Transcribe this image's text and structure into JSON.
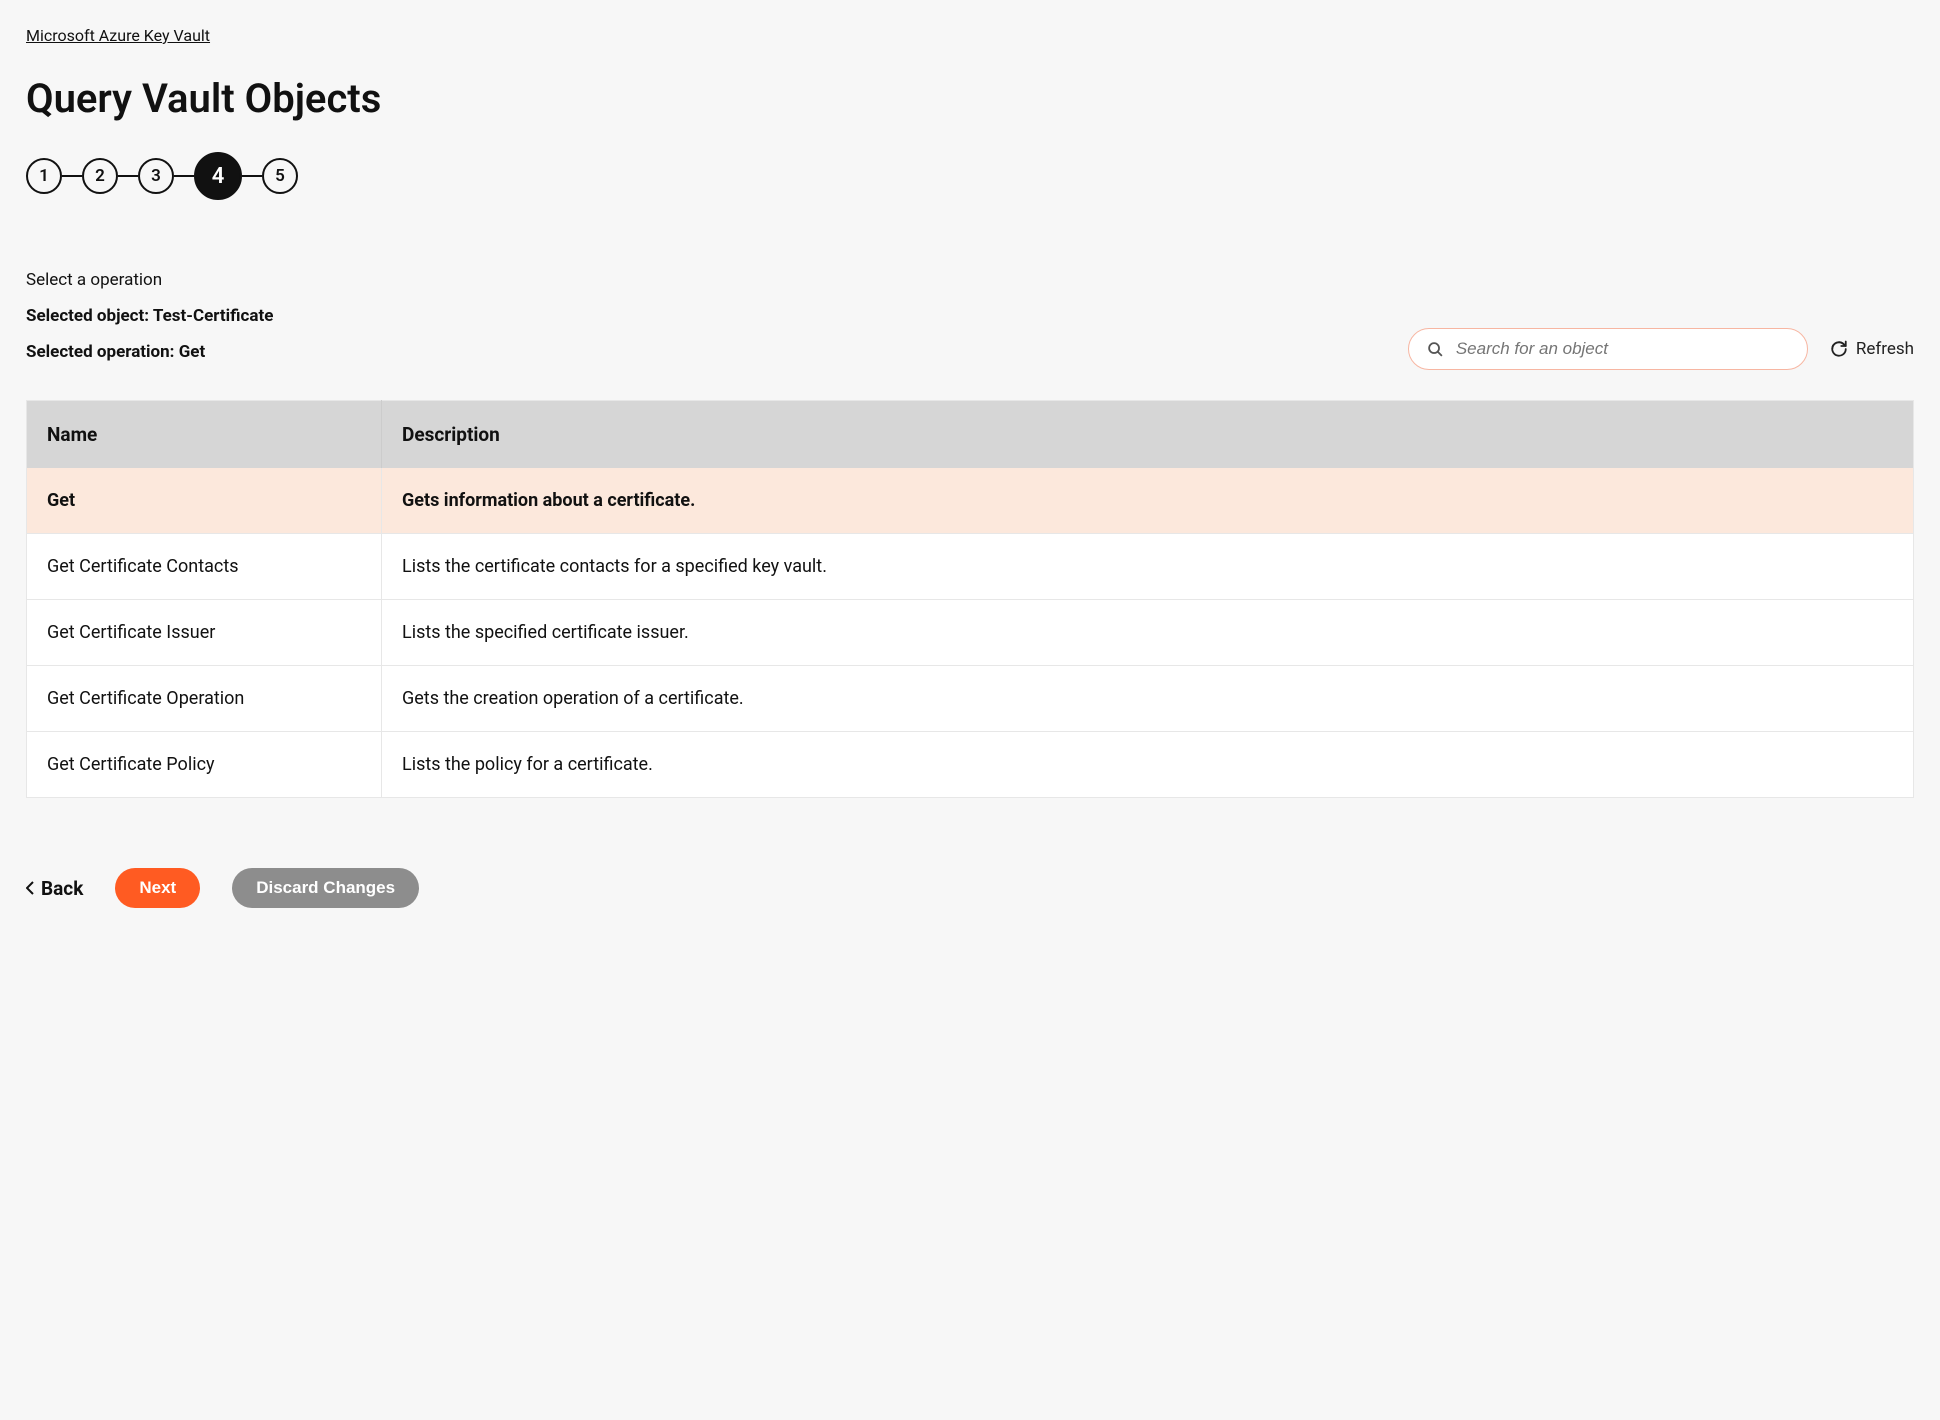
{
  "breadcrumb": "Microsoft Azure Key Vault",
  "page_title": "Query Vault Objects",
  "stepper": {
    "steps": [
      "1",
      "2",
      "3",
      "4",
      "5"
    ],
    "active_index": 3
  },
  "info": {
    "prompt": "Select a operation",
    "selected_object_label": "Selected object: Test-Certificate",
    "selected_operation_label": "Selected operation: Get"
  },
  "search": {
    "placeholder": "Search for an object"
  },
  "refresh_label": "Refresh",
  "table": {
    "headers": {
      "name": "Name",
      "description": "Description"
    },
    "rows": [
      {
        "name": "Get",
        "description": "Gets information about a certificate.",
        "selected": true
      },
      {
        "name": "Get Certificate Contacts",
        "description": "Lists the certificate contacts for a specified key vault.",
        "selected": false
      },
      {
        "name": "Get Certificate Issuer",
        "description": "Lists the specified certificate issuer.",
        "selected": false
      },
      {
        "name": "Get Certificate Operation",
        "description": "Gets the creation operation of a certificate.",
        "selected": false
      },
      {
        "name": "Get Certificate Policy",
        "description": "Lists the policy for a certificate.",
        "selected": false
      }
    ]
  },
  "actions": {
    "back": "Back",
    "next": "Next",
    "discard": "Discard Changes"
  }
}
